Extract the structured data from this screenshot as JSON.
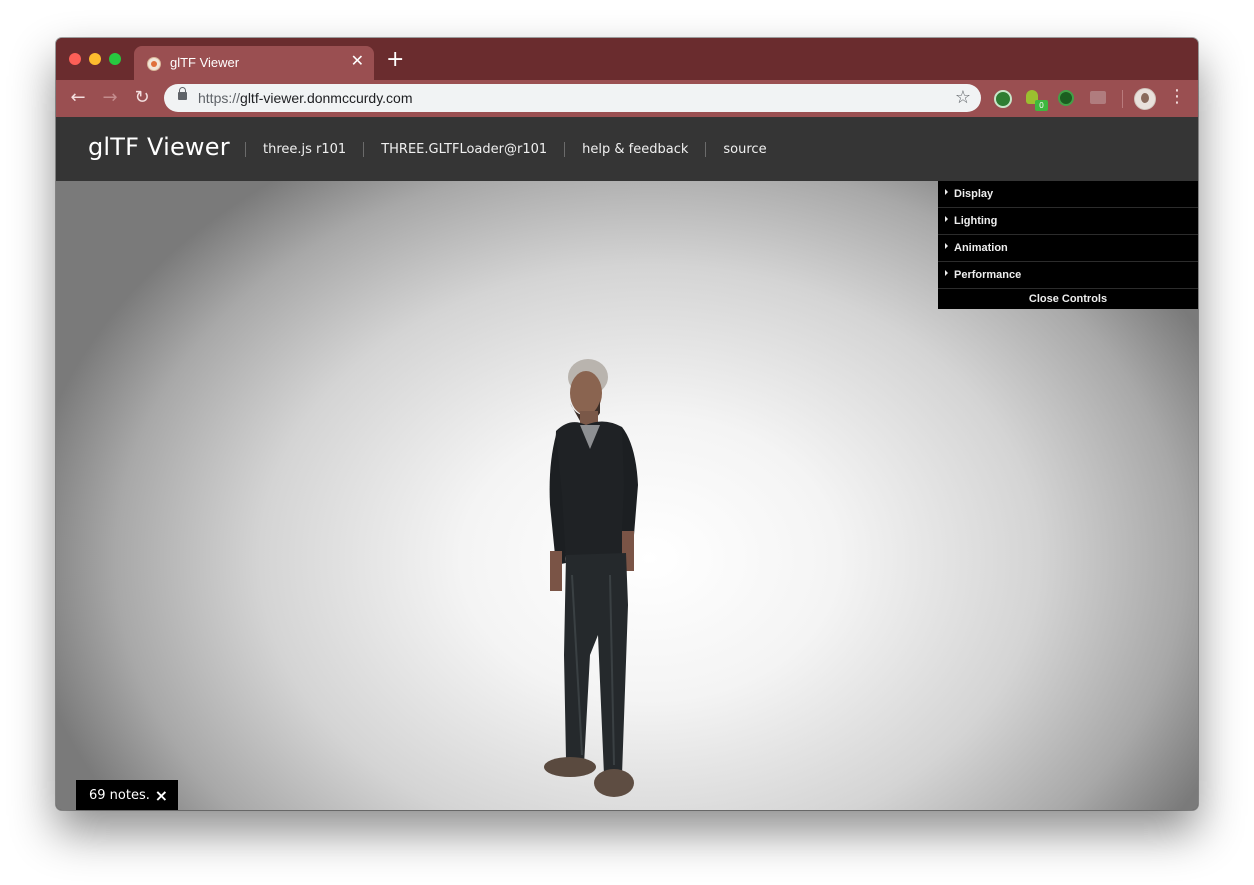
{
  "browser": {
    "tab": {
      "title": "glTF Viewer",
      "close": "✕",
      "favicon": "gltf-favicon"
    },
    "new_tab": "+",
    "nav": {
      "back": "←",
      "forward": "→",
      "reload": "↻"
    },
    "url_scheme": "https://",
    "url_host": "gltf-viewer.donmccurdy.com",
    "bookmark_star": "☆",
    "menu": "⋮",
    "extensions": [
      {
        "name": "ghostery-icon",
        "color": "#2e7d32"
      },
      {
        "name": "bulb-extension-icon",
        "badge": "0",
        "color": "#9bbf2f"
      },
      {
        "name": "vpn-extension-icon",
        "color": "#1b5e20"
      },
      {
        "name": "chat-extension-icon",
        "color": "#b07c7e"
      }
    ],
    "theme": {
      "tabstrip": "#6a2c2e",
      "toolbar": "#9a4f51"
    }
  },
  "site": {
    "title": "glTF Viewer",
    "nav": [
      {
        "label": "three.js r101"
      },
      {
        "label": "THREE.GLTFLoader@r101"
      },
      {
        "label": "help & feedback"
      },
      {
        "label": "source"
      }
    ]
  },
  "controls": {
    "folders": [
      {
        "label": "Display"
      },
      {
        "label": "Lighting"
      },
      {
        "label": "Animation"
      },
      {
        "label": "Performance"
      }
    ],
    "close_label": "Close Controls"
  },
  "notes": {
    "text": "69 notes.",
    "close": "×"
  }
}
